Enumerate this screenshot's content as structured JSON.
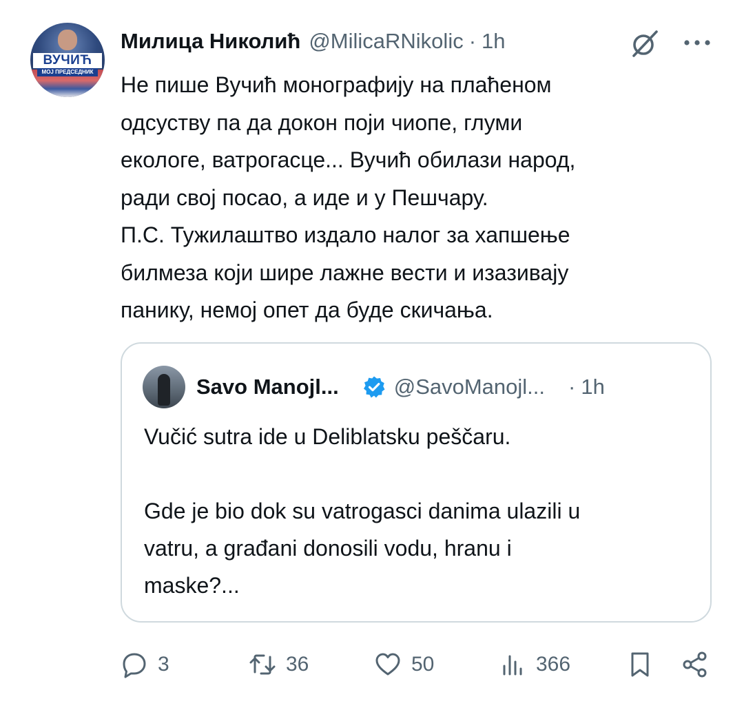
{
  "tweet": {
    "author_name": "Милица Николић",
    "author_handle": "@MilicaRNikolic",
    "separator": "·",
    "time": "1h",
    "avatar": {
      "banner_text": "ВУЧИЋ",
      "sub_text": "МОЈ ПРЕДСЕДНИК"
    },
    "text_lines": [
      "Не пише Вучић монографију на плаћеном",
      "одсуству па да докон поји чиопе, глуми",
      "екологе, ватрогасце... Вучић обилази народ,",
      "ради свој посао, а иде и у Пешчару.",
      "П.С. Тужилаштво издало налог за хапшење",
      "билмеза који шире лажне вести и изазивају",
      "панику, немој опет да буде скичања."
    ]
  },
  "quoted_tweet": {
    "author_name": "Savo Manojl...",
    "author_handle": "@SavoManojl...",
    "separator": "·",
    "time": "1h",
    "verified_icon": "verified-badge-icon",
    "paragraph_1": "Vučić sutra ide u Deliblatsku peščaru.",
    "paragraph_2_lines": [
      "Gde je bio dok su vatrogasci danima ulazili u",
      "vatru, a građani donosili vodu, hranu i",
      "maske?..."
    ]
  },
  "actions": {
    "reply": {
      "icon": "reply-icon",
      "count": "3"
    },
    "retweet": {
      "icon": "retweet-icon",
      "count": "36"
    },
    "like": {
      "icon": "heart-icon",
      "count": "50"
    },
    "views": {
      "icon": "views-icon",
      "count": "366"
    },
    "bookmark": {
      "icon": "bookmark-icon"
    },
    "share": {
      "icon": "share-icon"
    }
  },
  "colors": {
    "text_primary": "#0f1419",
    "text_secondary": "#536471",
    "verified_blue": "#1d9bf0",
    "border": "#cfd9de"
  }
}
